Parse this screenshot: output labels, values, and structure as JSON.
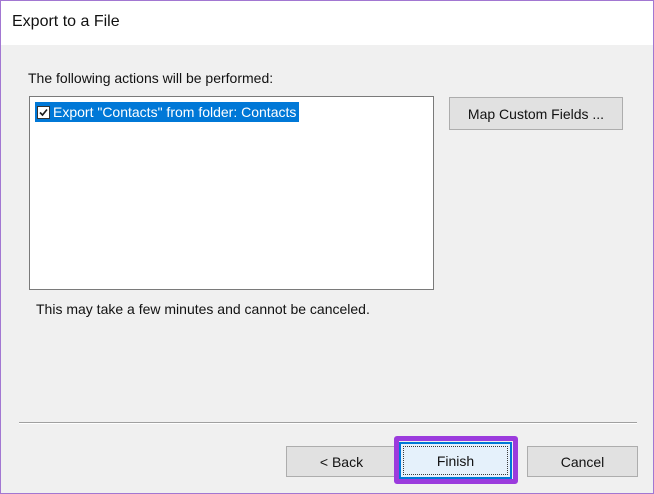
{
  "window": {
    "title": "Export to a File"
  },
  "actions": {
    "label": "The following actions will be performed:",
    "items": [
      {
        "text": "Export \"Contacts\" from folder: Contacts",
        "checked": true,
        "selected": true
      }
    ]
  },
  "buttons": {
    "map_custom_fields": "Map Custom Fields ...",
    "back": "< Back",
    "finish": "Finish",
    "cancel": "Cancel"
  },
  "note": "This may take a few minutes and cannot be canceled.",
  "colors": {
    "selection": "#0078d7",
    "highlight_outline": "#9b3bdd",
    "window_border": "#a277d2"
  },
  "icons": {
    "checkbox": "checkmark-icon"
  }
}
